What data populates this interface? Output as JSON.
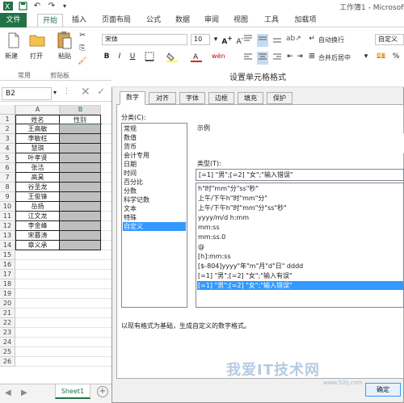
{
  "window": {
    "title": "工作簿1 - Microsoft"
  },
  "ribbon_tabs": [
    "文件",
    "开始",
    "插入",
    "页面布局",
    "公式",
    "数据",
    "审阅",
    "视图",
    "工具",
    "加载项"
  ],
  "ribbon": {
    "paste_new": "新建",
    "open": "打开",
    "paste": "粘贴",
    "font_name": "宋体",
    "font_size": "10",
    "wrap_text": "自动换行",
    "merge_center": "合并后居中",
    "number_format": "自定义",
    "groups": {
      "common": "常用",
      "clipboard": "剪贴板"
    }
  },
  "formula_bar": {
    "name_box": "B2"
  },
  "sheet": {
    "columns": [
      "A",
      "B"
    ],
    "header": {
      "row": "1",
      "a": "姓名",
      "b": "性别"
    },
    "rows": [
      {
        "n": "2",
        "a": "王高敏"
      },
      {
        "n": "3",
        "a": "李敏枉"
      },
      {
        "n": "4",
        "a": "慧琪"
      },
      {
        "n": "5",
        "a": "叶孝贤"
      },
      {
        "n": "6",
        "a": "张洁"
      },
      {
        "n": "7",
        "a": "高昊"
      },
      {
        "n": "8",
        "a": "谷圣龙"
      },
      {
        "n": "9",
        "a": "王俊锋"
      },
      {
        "n": "10",
        "a": "岳扬"
      },
      {
        "n": "11",
        "a": "江文龙"
      },
      {
        "n": "12",
        "a": "李金峰"
      },
      {
        "n": "13",
        "a": "宋募涛"
      },
      {
        "n": "14",
        "a": "章义承"
      }
    ],
    "empty_rows": [
      "15",
      "16",
      "17",
      "18",
      "19",
      "20",
      "21",
      "22",
      "23",
      "24",
      "25",
      "26"
    ],
    "sheet_tab": "Sheet1"
  },
  "dialog": {
    "title": "设置单元格格式",
    "tabs": [
      "数字",
      "对齐",
      "字体",
      "边框",
      "填充",
      "保护"
    ],
    "category_label": "分类(C):",
    "categories": [
      "常规",
      "数值",
      "货币",
      "会计专用",
      "日期",
      "时间",
      "百分比",
      "分数",
      "科学记数",
      "文本",
      "特殊",
      "自定义"
    ],
    "selected_category": "自定义",
    "sample_label": "示例",
    "type_label": "类型(T):",
    "type_value": "[=1] \"男\";[=2] \"女\";\"输入错误\"",
    "formats": [
      "h\"时\"mm\"分\"ss\"秒\"",
      "上午/下午h\"时\"mm\"分\"",
      "上午/下午h\"时\"mm\"分\"ss\"秒\"",
      "yyyy/m/d h:mm",
      "mm:ss",
      "mm:ss.0",
      "@",
      "[h]:mm:ss",
      "[$-804]yyyy\"年\"m\"月\"d\"日\" dddd",
      "[=1] \"男\";[=2] \"女\";\"输入有误\"",
      "[=1] \"男\";[=2] \"女\";\"输入错误\""
    ],
    "selected_format": "[=1] \"男\";[=2] \"女\";\"输入错误\"",
    "description": "以现有格式为基础，生成自定义的数字格式。",
    "ok_button": "确定"
  },
  "watermark": {
    "text": "我爱IT技术网",
    "url": "www.52ij.com"
  },
  "colors": {
    "excel_green": "#217346",
    "selection_blue": "#3399ff",
    "gender_fill": "#bfbfbf"
  }
}
